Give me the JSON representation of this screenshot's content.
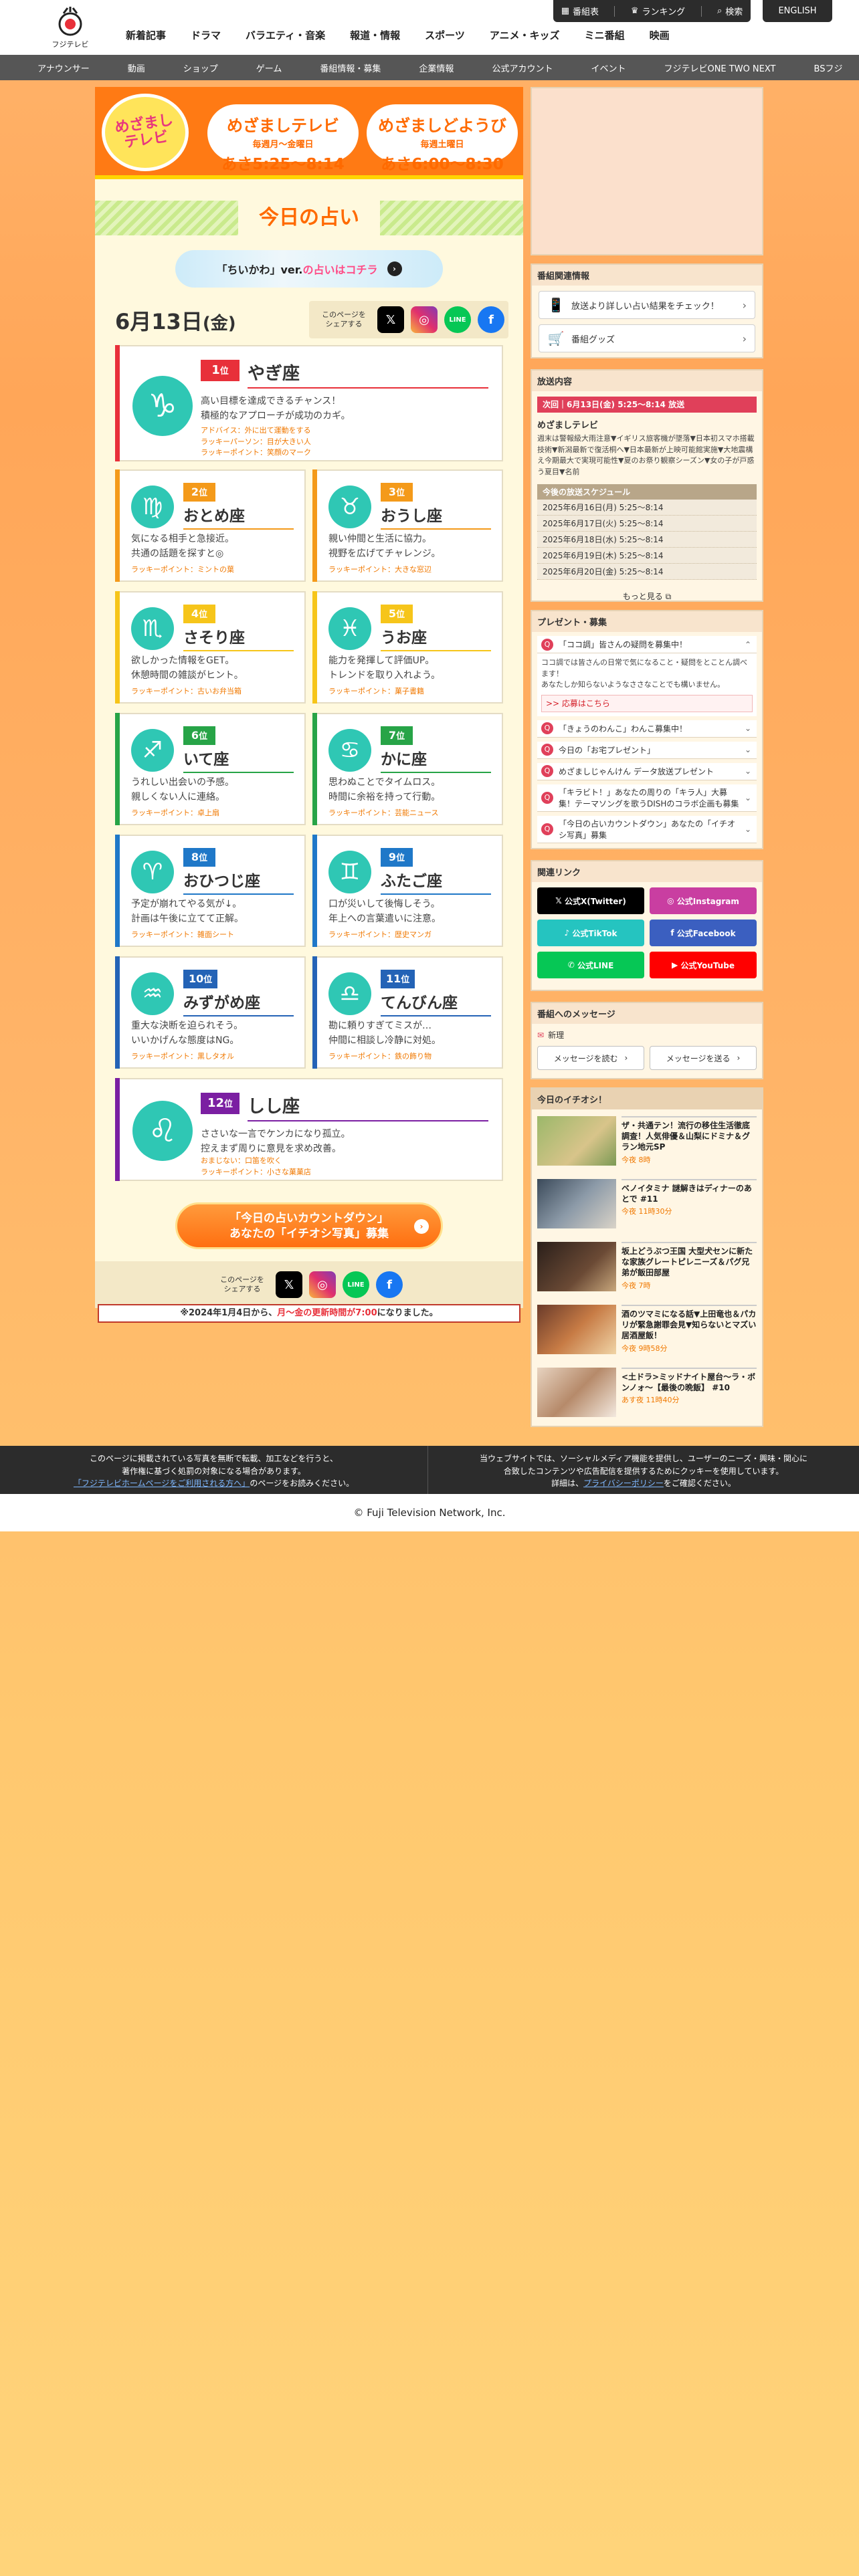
{
  "header": {
    "logo_text": "フジテレビ",
    "nav": [
      "新着記事",
      "ドラマ",
      "バラエティ・音楽",
      "報道・情報",
      "スポーツ",
      "アニメ・キッズ",
      "ミニ番組",
      "映画"
    ],
    "tools": [
      "番組表",
      "ランキング",
      "検索"
    ],
    "english": "ENGLISH",
    "subnav": [
      "アナウンサー",
      "動画",
      "ショップ",
      "ゲーム",
      "番組情報・募集",
      "企業情報",
      "公式アカウント",
      "イベント",
      "フジテレビONE TWO NEXT",
      "BSフジ"
    ]
  },
  "banner": {
    "logo_text": "めざまし\nテレビ",
    "pill1": {
      "title": "めざましテレビ",
      "sub": "毎週月～金曜日",
      "time": "あさ5:25～8:14"
    },
    "pill2": {
      "title": "めざましどようび",
      "sub": "毎週土曜日",
      "time": "あさ6:00～8:30"
    }
  },
  "main": {
    "title": "今日の占い",
    "chiikawa_a": "「ちいかわ」ver.",
    "chiikawa_b": "の占いはコチラ",
    "date_month_day": "6月13日",
    "date_weekday": "(金)",
    "share_label": "このページを\nシェアする"
  },
  "fortunes": [
    {
      "rank": "1",
      "unit": "位",
      "sign": "やぎ座",
      "symbol": "♑",
      "desc": "高い目標を達成できるチャンス！\n積極的なアプローチが成功のカギ。",
      "lucky": "アドバイス：外に出て運動をする\nラッキーパーソン：目が大きい人\nラッキーポイント：笑顔のマーク"
    },
    {
      "rank": "2",
      "unit": "位",
      "sign": "おとめ座",
      "symbol": "♍",
      "desc": "気になる相手と急接近。\n共通の話題を探すと◎",
      "lucky": "ラッキーポイント：ミントの葉"
    },
    {
      "rank": "3",
      "unit": "位",
      "sign": "おうし座",
      "symbol": "♉",
      "desc": "親い仲間と生活に協力。\n視野を広げてチャレンジ。",
      "lucky": "ラッキーポイント：大きな窓辺"
    },
    {
      "rank": "4",
      "unit": "位",
      "sign": "さそり座",
      "symbol": "♏",
      "desc": "欲しかった情報をGET。\n休憩時間の雑談がヒント。",
      "lucky": "ラッキーポイント：古いお弁当箱"
    },
    {
      "rank": "5",
      "unit": "位",
      "sign": "うお座",
      "symbol": "♓",
      "desc": "能力を発揮して評価UP。\nトレンドを取り入れよう。",
      "lucky": "ラッキーポイント：菓子書籍"
    },
    {
      "rank": "6",
      "unit": "位",
      "sign": "いて座",
      "symbol": "♐",
      "desc": "うれしい出会いの予感。\n親しくない人に連絡。",
      "lucky": "ラッキーポイント：卓上扇"
    },
    {
      "rank": "7",
      "unit": "位",
      "sign": "かに座",
      "symbol": "♋",
      "desc": "思わぬことでタイムロス。\n時間に余裕を持って行動。",
      "lucky": "ラッキーポイント：芸能ニュース"
    },
    {
      "rank": "8",
      "unit": "位",
      "sign": "おひつじ座",
      "symbol": "♈",
      "desc": "予定が崩れてやる気が↓。\n計画は午後に立てて正解。",
      "lucky": "ラッキーポイント：雑面シート"
    },
    {
      "rank": "9",
      "unit": "位",
      "sign": "ふたご座",
      "symbol": "♊",
      "desc": "口が災いして後悔しそう。\n年上への言葉遣いに注意。",
      "lucky": "ラッキーポイント：歴史マンガ"
    },
    {
      "rank": "10",
      "unit": "位",
      "sign": "みずがめ座",
      "symbol": "♒",
      "desc": "重大な決断を迫られそう。\nいいかげんな態度はNG。",
      "lucky": "ラッキーポイント：黒しタオル"
    },
    {
      "rank": "11",
      "unit": "位",
      "sign": "てんびん座",
      "symbol": "♎",
      "desc": "勘に頼りすぎてミスが…\n仲間に相談し冷静に対処。",
      "lucky": "ラッキーポイント：鉄の飾り物"
    },
    {
      "rank": "12",
      "unit": "位",
      "sign": "しし座",
      "symbol": "♌",
      "desc": "ささいな一言でケンカになり孤立。\n控えまず周りに意見を求め改善。",
      "lucky": "おまじない：口笛を吹く\nラッキーポイント：小さな菓菓店"
    }
  ],
  "countdown": {
    "line1": "「今日の占いカウントダウン」",
    "line2": "あなたの「イチオシ写真」募集"
  },
  "notice": {
    "pre": "※2024年1月4日から、",
    "red": "月～金の更新時間が7:00",
    "post": "になりました。"
  },
  "sidebar": {
    "related_head": "番組関連情報",
    "related_items": [
      "放送より詳しい占い結果をチェック！",
      "番組グッズ"
    ],
    "onair_head": "放送内容",
    "next_bar": "次回｜6月13日(金) 5:25～8:14 放送",
    "prog_title": "めざましテレビ",
    "prog_desc": "週末は警報級大雨注意▼イギリス旅客機が墜落▼日本初スマホ搭載技術▼新潟最新で復活桐へ▼日本最新が上映可能館実施▼大地震構え今期最大で実現可能性▼夏のお祭り観察シーズン▼女の子が戸惑う夏目▼名前",
    "sched_head": "今後の放送スケジュール",
    "schedule": [
      "2025年6月16日(月) 5:25～8:14",
      "2025年6月17日(火) 5:25～8:14",
      "2025年6月18日(水) 5:25～8:14",
      "2025年6月19日(木) 5:25～8:14",
      "2025年6月20日(金) 5:25～8:14"
    ],
    "more": "もっと見る",
    "present_head": "プレゼント・募集",
    "present_open": "「ココ調」皆さんの疑問を募集中！",
    "present_body": "ココ調では皆さんの日常で気になること・疑問をとことん調べます！\nあなたしか知らないようなささなことでも構いません。",
    "present_link": ">> 応募はこちら",
    "present_items": [
      "「きょうのわんこ」わんこ募集中！",
      "今日の「お宅プレゼント」",
      "めざましじゃんけん データ放送プレゼント",
      "「キラビト！」あなたの周りの「キラ人」大募集！テーマソングを歌うDISHのコラボ企画も募集",
      "「今日の占いカウントダウン」あなたの「イチオシ写真」募集"
    ],
    "links_head": "関連リンク",
    "links": [
      "公式X(Twitter)",
      "公式Instagram",
      "公式TikTok",
      "公式Facebook",
      "公式LINE",
      "公式YouTube"
    ],
    "message_head": "番組へのメッセージ",
    "message_new": "新理",
    "message_btns": [
      "メッセージを読む",
      "メッセージを送る"
    ],
    "ichioshi_head": "今日のイチオシ！",
    "news": [
      {
        "title": "ザ・共通テン！流行の移住生活徹底調査！人気俳優＆山梨にドミナ＆グラン地元SP",
        "time": "今夜 8時"
      },
      {
        "title": "ベノイタミナ 謎解きはディナーのあとで #11",
        "time": "今夜 11時30分"
      },
      {
        "title": "坂上どうぶつ王国 大型犬センに新たな家族グレートピレニーズ＆パグ兄弟が飯田部屋",
        "time": "今夜 7時"
      },
      {
        "title": "酒のツマミになる話▼上田竜也＆パカリが緊急謝罪会見▼知らないとマズい居酒屋飯！",
        "time": "今夜 9時58分"
      },
      {
        "title": "<土ドラ>ミッドナイト屋台～ラ・ボンノォ～【最後の晩飯】 #10",
        "time": "あす夜 11時40分"
      }
    ]
  },
  "footer": {
    "left_lines": [
      "このページに掲載されている写真を無断で転載、加工などを行うと、",
      "著作権に基づく処罰の対象になる場合があります。"
    ],
    "left_link": "「フジテレビホームページをご利用される方へ」",
    "left_suffix": "のページをお読みください。",
    "right_lines": [
      "当ウェブサイトでは、ソーシャルメディア機能を提供し、ユーザーのニーズ・興味・関心に",
      "合致したコンテンツや広告配信を提供するためにクッキーを使用しています。"
    ],
    "right_pre": "詳細は、",
    "right_link": "プライバシーポリシー",
    "right_suffix": "をご確認ください。",
    "copyright": "© Fuji Television Network, Inc."
  },
  "colors": {
    "brand_orange": "#ff7a14",
    "accent_pink": "#e0405a",
    "title_orange": "#ff6a00"
  }
}
